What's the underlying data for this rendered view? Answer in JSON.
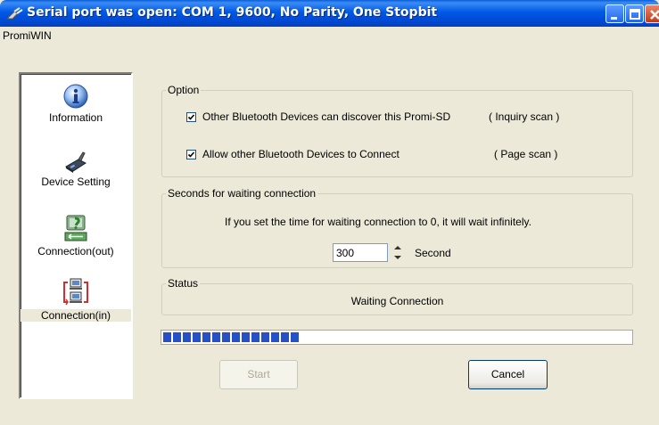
{
  "window": {
    "title": "Serial port was open: COM 1, 9600, No Parity, One Stopbit",
    "accent": "#0054E3"
  },
  "menu": {
    "items": [
      {
        "label": "PromiWIN"
      }
    ]
  },
  "sidebar": {
    "items": [
      {
        "label": "Information",
        "icon": "information-icon",
        "active": false
      },
      {
        "label": "Device Setting",
        "icon": "device-icon",
        "active": false
      },
      {
        "label": "Connection(out)",
        "icon": "connection-out-icon",
        "active": false
      },
      {
        "label": "Connection(in)",
        "icon": "connection-in-icon",
        "active": true
      }
    ]
  },
  "option": {
    "title": "Option",
    "inquiry": {
      "label": "Other Bluetooth Devices can discover this Promi-SD",
      "hint": "( Inquiry scan )",
      "checked": true
    },
    "page": {
      "label": "Allow other Bluetooth Devices to Connect",
      "hint": "( Page scan )",
      "checked": true
    }
  },
  "waiting": {
    "title": "Seconds for waiting connection",
    "note": "If you set the time for waiting connection to 0, it will wait infinitely.",
    "value": "300",
    "unit": "Second"
  },
  "status": {
    "title": "Status",
    "text": "Waiting Connection"
  },
  "progress": {
    "segments_filled": 14,
    "color": "#2550C8"
  },
  "buttons": {
    "start": {
      "label": "Start",
      "enabled": false
    },
    "cancel": {
      "label": "Cancel",
      "enabled": true
    }
  }
}
